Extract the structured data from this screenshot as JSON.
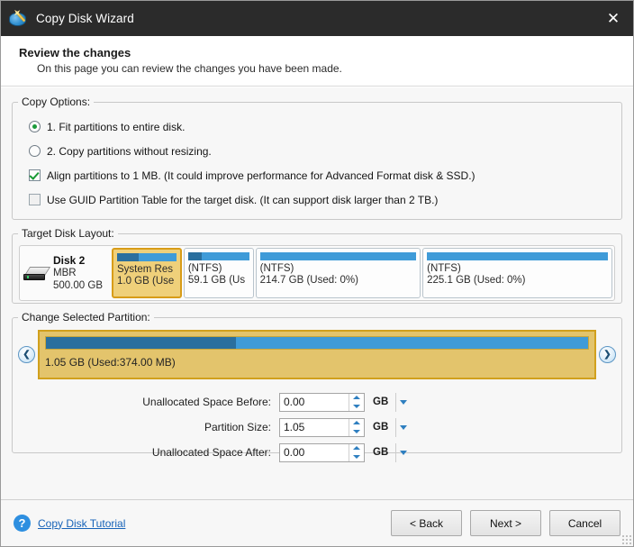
{
  "window": {
    "title": "Copy Disk Wizard",
    "app_icon": "disk-wand-icon",
    "close_label": "✕"
  },
  "header": {
    "title": "Review the changes",
    "subtitle": "On this page you can review the changes you have been made."
  },
  "copy_options": {
    "legend": "Copy Options:",
    "items": [
      {
        "type": "radio",
        "checked": true,
        "label": "1. Fit partitions to entire disk."
      },
      {
        "type": "radio",
        "checked": false,
        "label": "2. Copy partitions without resizing."
      },
      {
        "type": "checkbox",
        "checked": true,
        "label": "Align partitions to 1 MB.  (It could improve performance for Advanced Format disk & SSD.)"
      },
      {
        "type": "checkbox",
        "checked": false,
        "label": "Use GUID Partition Table for the target disk. (It can support disk larger than 2 TB.)"
      }
    ]
  },
  "target_disk_layout": {
    "legend": "Target Disk Layout:",
    "disk": {
      "name": "Disk 2",
      "scheme": "MBR",
      "capacity": "500.00 GB",
      "icon": "hard-disk-icon"
    },
    "partitions": [
      {
        "label": "System Res",
        "size_text": "1.0 GB (Use",
        "used_pct": 36,
        "selected": true,
        "width_pct": 14
      },
      {
        "label": "(NTFS)",
        "size_text": "59.1 GB (Us",
        "used_pct": 23,
        "selected": false,
        "width_pct": 14
      },
      {
        "label": "(NTFS)",
        "size_text": "214.7 GB (Used: 0%)",
        "used_pct": 0,
        "selected": false,
        "width_pct": 33
      },
      {
        "label": "(NTFS)",
        "size_text": "225.1 GB (Used: 0%)",
        "used_pct": 0,
        "selected": false,
        "width_pct": 39
      }
    ]
  },
  "change_selected_partition": {
    "legend": "Change Selected Partition:",
    "prev_label": "❮",
    "next_label": "❯",
    "bar_used_pct": 35,
    "caption": "1.05 GB (Used:374.00 MB)",
    "fields": [
      {
        "label": "Unallocated Space Before:",
        "value": "0.00",
        "unit": "GB"
      },
      {
        "label": "Partition Size:",
        "value": "1.05",
        "unit": "GB"
      },
      {
        "label": "Unallocated Space After:",
        "value": "0.00",
        "unit": "GB"
      }
    ]
  },
  "footer": {
    "help_icon": "question-mark-icon",
    "tutorial_link": "Copy Disk Tutorial",
    "back_label": "< Back",
    "next_label": "Next >",
    "cancel_label": "Cancel"
  },
  "colors": {
    "titlebar": "#2b2b2b",
    "selection": "#e3c46c",
    "selection_border": "#d1a01d",
    "partition_free": "#3f9bd8",
    "partition_used": "#2a6f9e",
    "link": "#1763b8",
    "accent": "#2e8fe0"
  }
}
